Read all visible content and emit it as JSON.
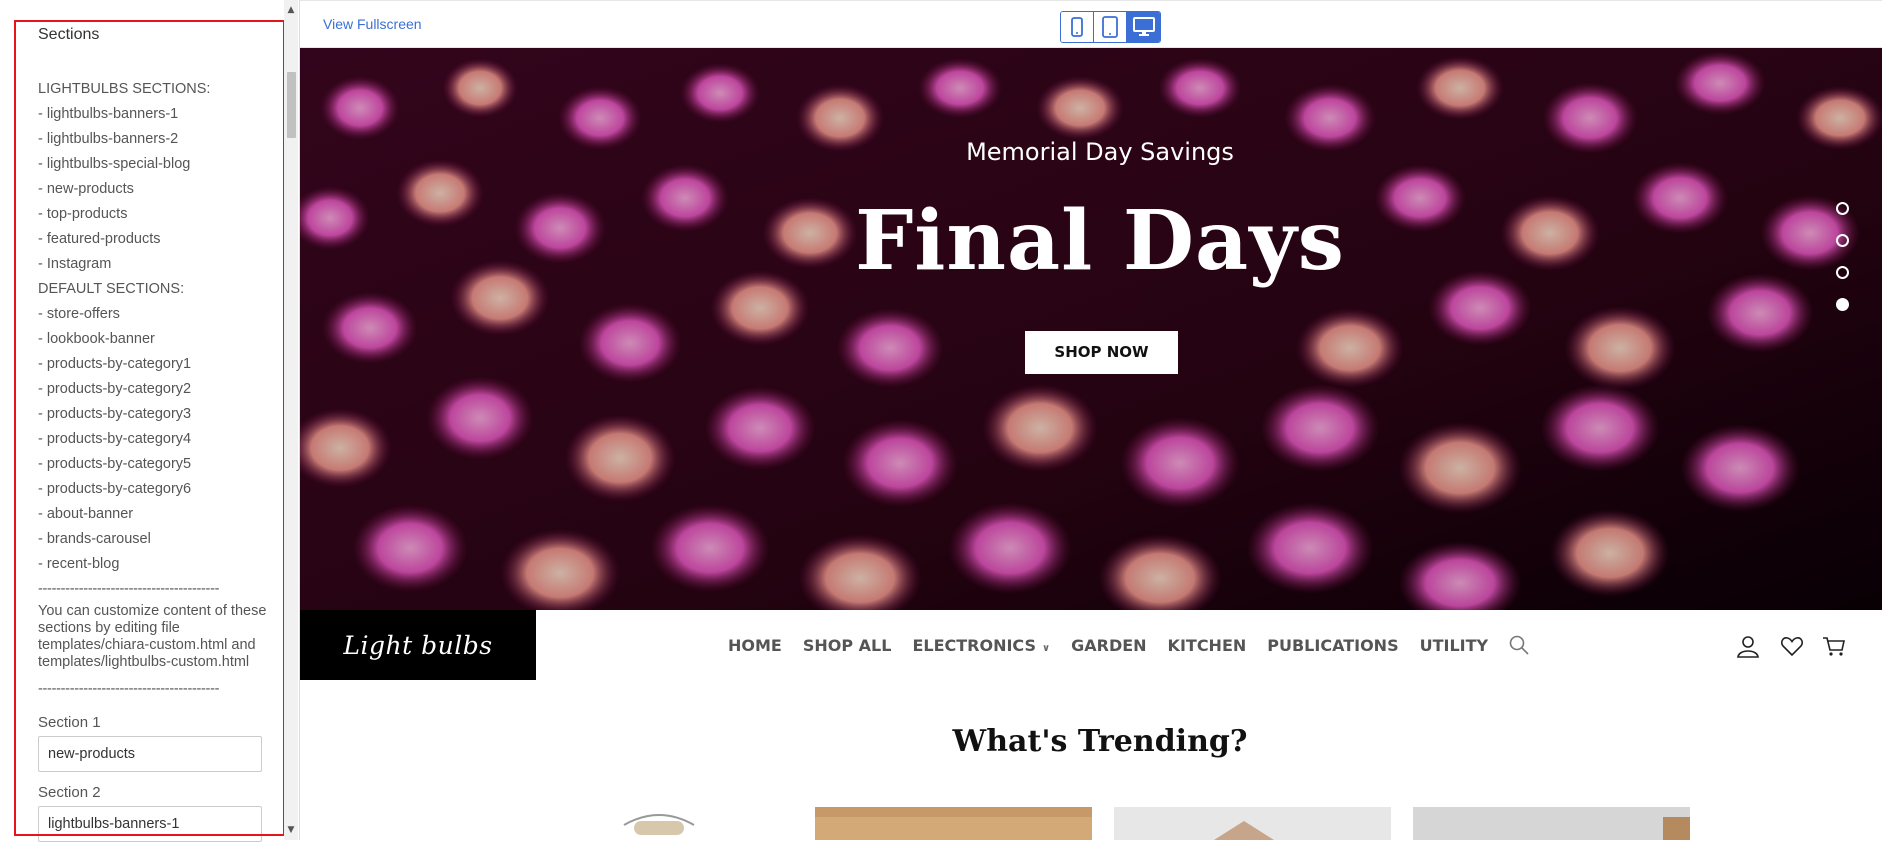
{
  "sidebar": {
    "title": "Sections",
    "lightbulbs_heading": "LIGHTBULBS SECTIONS:",
    "lightbulbs_items": [
      "- lightbulbs-banners-1",
      "- lightbulbs-banners-2",
      "- lightbulbs-special-blog",
      "- new-products",
      "- top-products",
      "- featured-products",
      "- Instagram"
    ],
    "default_heading": "DEFAULT SECTIONS:",
    "default_items": [
      "- store-offers",
      "- lookbook-banner",
      "- products-by-category1",
      "- products-by-category2",
      "- products-by-category3",
      "- products-by-category4",
      "- products-by-category5",
      "- products-by-category6",
      "- about-banner",
      "- brands-carousel",
      "- recent-blog"
    ],
    "divider": "----------------------------------------",
    "note": "You can customize content of these sections by editing file templates/chiara-custom.html and templates/lightbulbs-custom.html",
    "section1_label": "Section 1",
    "section1_value": "new-products",
    "section2_label": "Section 2",
    "section2_value": "lightbulbs-banners-1"
  },
  "preview_bar": {
    "view_fullscreen": "View Fullscreen",
    "devices": [
      "mobile-icon",
      "tablet-icon",
      "desktop-icon"
    ],
    "active_device": "desktop-icon"
  },
  "hero": {
    "subtitle": "Memorial Day Savings",
    "title": "Final Days",
    "button": "SHOP NOW",
    "slide_count": 4,
    "active_slide": 4
  },
  "header": {
    "logo": "Light bulbs",
    "nav": [
      "HOME",
      "SHOP ALL",
      "ELECTRONICS",
      "GARDEN",
      "KITCHEN",
      "PUBLICATIONS",
      "UTILITY"
    ]
  },
  "trending": {
    "title": "What's Trending?"
  },
  "colors": {
    "accent": "#3b6fd6",
    "panel_highlight": "#e8141c",
    "logo_bg": "#000000"
  }
}
